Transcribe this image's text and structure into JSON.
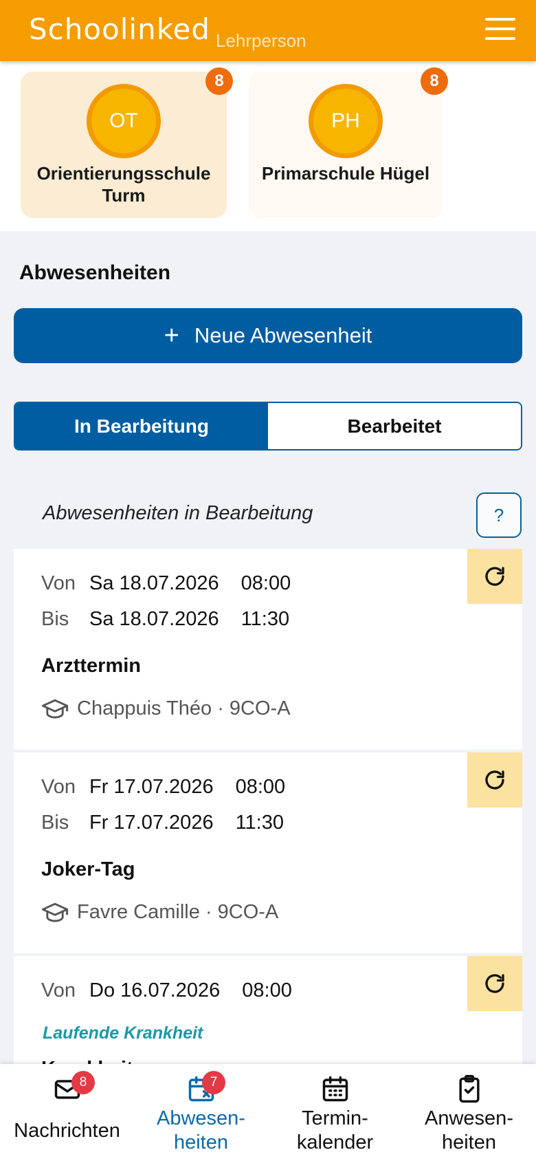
{
  "header": {
    "logo": "Schoolinked",
    "role": "Lehrperson",
    "menu_icon": "hamburger-menu-icon"
  },
  "schools": [
    {
      "initials": "OT",
      "name": "Orientierungsschule Turm",
      "badge": "8",
      "active": true
    },
    {
      "initials": "PH",
      "name": "Primarschule Hügel",
      "badge": "8",
      "active": false
    }
  ],
  "section": {
    "title": "Abwesenheiten",
    "new_button": "Neue Abwesenheit"
  },
  "tabs": [
    {
      "label": "In Bearbeitung",
      "active": true
    },
    {
      "label": "Bearbeitet",
      "active": false
    }
  ],
  "list": {
    "title": "Abwesenheiten in Bearbeitung",
    "help": "?"
  },
  "cards": [
    {
      "from_label": "Von",
      "from_date": "Sa 18.07.2026",
      "from_time": "08:00",
      "to_label": "Bis",
      "to_date": "Sa 18.07.2026",
      "to_time": "11:30",
      "reason": "Arzttermin",
      "student": "Chappuis Théo · 9CO-A"
    },
    {
      "from_label": "Von",
      "from_date": "Fr 17.07.2026",
      "from_time": "08:00",
      "to_label": "Bis",
      "to_date": "Fr 17.07.2026",
      "to_time": "11:30",
      "reason": "Joker-Tag",
      "student": "Favre Camille · 9CO-A"
    },
    {
      "from_label": "Von",
      "from_date": "Do 16.07.2026",
      "from_time": "08:00",
      "status": "Laufende Krankheit",
      "reason": "Krankheit"
    }
  ],
  "bottom_nav": [
    {
      "label": "Nachrichten",
      "icon": "envelope-icon",
      "badge": "8",
      "active": false
    },
    {
      "label": "Abwesen-\nheiten",
      "icon": "calendar-x-icon",
      "badge": "7",
      "active": true
    },
    {
      "label": "Termin-\nkalender",
      "icon": "calendar-icon",
      "active": false
    },
    {
      "label": "Anwesen-\nheiten",
      "icon": "clipboard-check-icon",
      "active": false
    }
  ],
  "colors": {
    "header": "#f59c00",
    "primary": "#005da2",
    "badge_orange": "#ef6c0c",
    "badge_red": "#e53945",
    "refresh_bg": "#fbe2a0",
    "ongoing": "#1b98a8"
  }
}
